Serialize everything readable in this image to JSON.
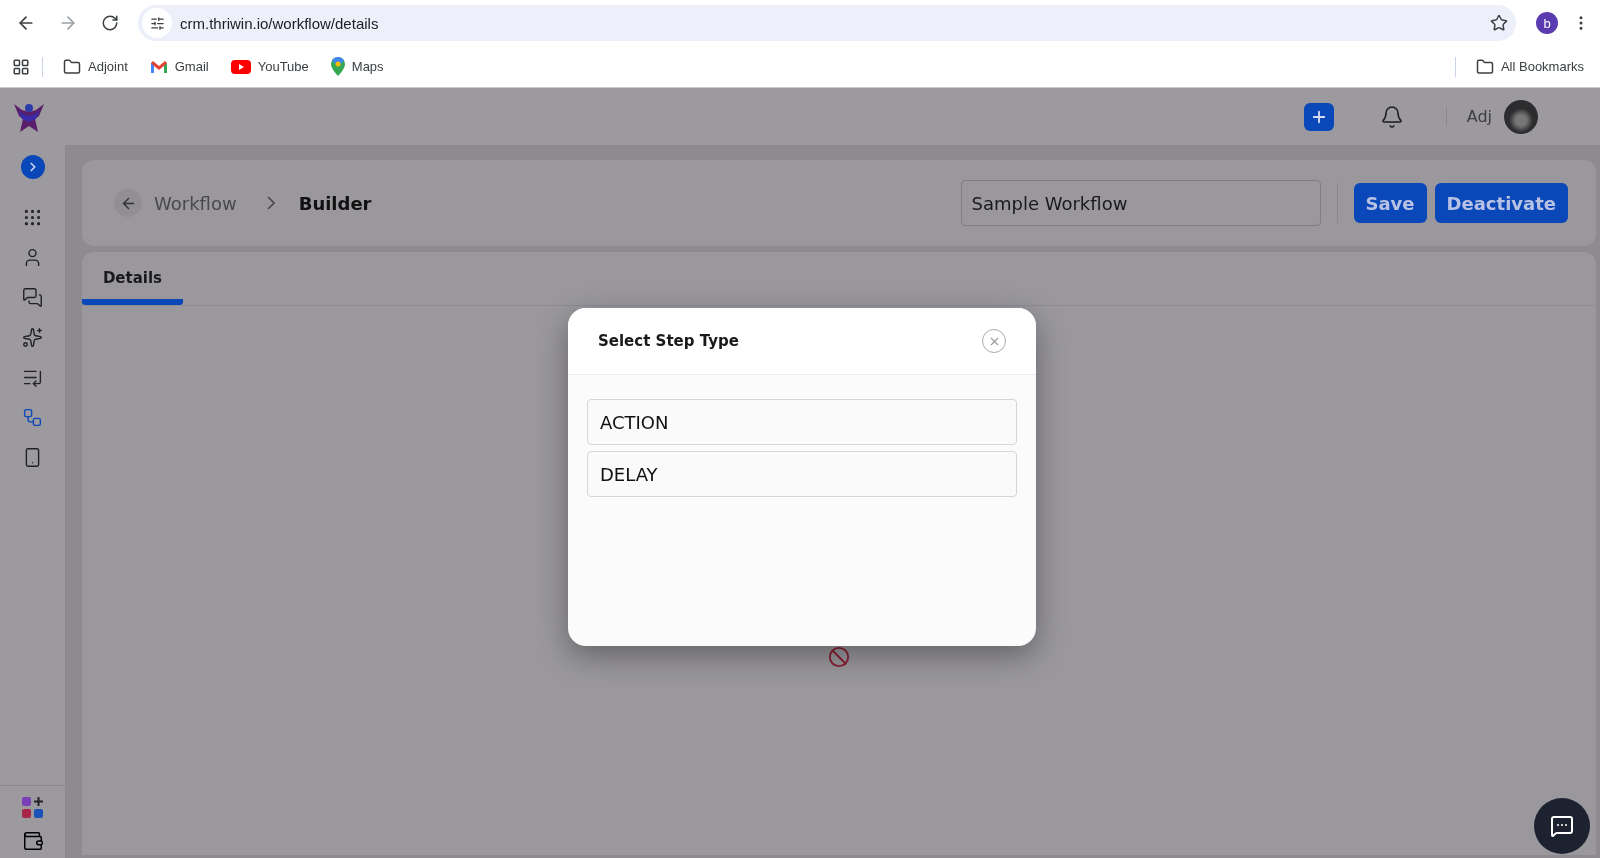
{
  "browser": {
    "url": "crm.thriwin.io/workflow/details",
    "profile_initial": "b",
    "bookmarks": [
      {
        "label": "Adjoint",
        "kind": "folder"
      },
      {
        "label": "Gmail",
        "kind": "gmail"
      },
      {
        "label": "YouTube",
        "kind": "youtube"
      },
      {
        "label": "Maps",
        "kind": "maps"
      }
    ],
    "all_bookmarks": "All Bookmarks"
  },
  "sidebar": {
    "items": [
      {
        "kind": "phone",
        "selected": false
      },
      {
        "kind": "contact",
        "selected": false
      },
      {
        "kind": "chat",
        "selected": false
      },
      {
        "kind": "sparkle",
        "selected": false
      },
      {
        "kind": "schedule",
        "selected": false
      },
      {
        "kind": "workflow",
        "selected": true
      },
      {
        "kind": "device",
        "selected": false
      }
    ]
  },
  "topbar": {
    "user": "Adj"
  },
  "header": {
    "breadcrumb": [
      "Workflow",
      "Builder"
    ],
    "workflow_name": "Sample Workflow",
    "buttons": [
      "Save",
      "Deactivate"
    ]
  },
  "tabs": [
    {
      "label": "Details",
      "selected": true
    }
  ],
  "modal": {
    "title": "Select Step Type",
    "options": [
      "ACTION",
      "DELAY"
    ]
  }
}
